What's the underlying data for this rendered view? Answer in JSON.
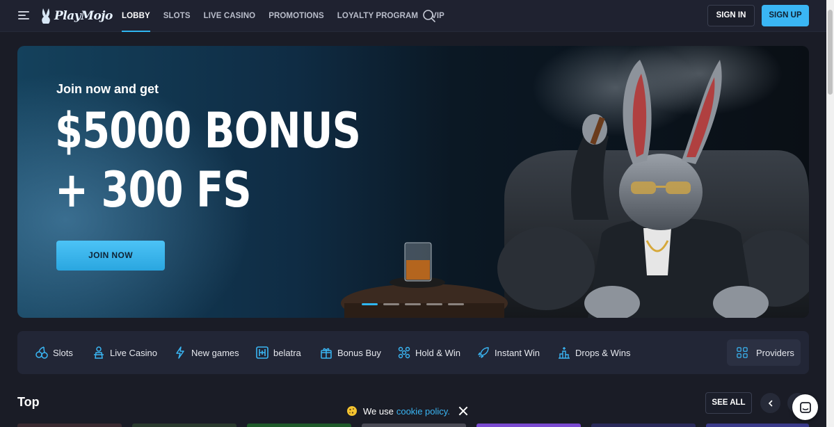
{
  "header": {
    "logo_text": "PlayMojo",
    "nav": [
      {
        "label": "LOBBY",
        "active": true
      },
      {
        "label": "SLOTS"
      },
      {
        "label": "LIVE CASINO"
      },
      {
        "label": "PROMOTIONS"
      },
      {
        "label": "LOYALTY PROGRAM"
      },
      {
        "label": "VIP"
      }
    ],
    "sign_in": "SIGN IN",
    "sign_up": "SIGN UP"
  },
  "hero": {
    "intro": "Join now and get",
    "headline_line1": "$5000 BONUS",
    "headline_line2": "+ 300 FS",
    "cta": "JOIN NOW",
    "slides": 5,
    "active_slide": 1
  },
  "categories": [
    {
      "label": "Slots",
      "icon": "cherries-icon"
    },
    {
      "label": "Live Casino",
      "icon": "dealer-icon"
    },
    {
      "label": "New games",
      "icon": "lightning-icon"
    },
    {
      "label": "belatra",
      "icon": "belatra-icon"
    },
    {
      "label": "Bonus Buy",
      "icon": "gift-icon"
    },
    {
      "label": "Hold & Win",
      "icon": "hold-win-icon"
    },
    {
      "label": "Instant Win",
      "icon": "rocket-icon"
    },
    {
      "label": "Drops & Wins",
      "icon": "drops-icon"
    }
  ],
  "providers_label": "Providers",
  "section": {
    "title": "Top",
    "see_all": "SEE ALL"
  },
  "cookie": {
    "text": "We use",
    "link": "cookie policy."
  },
  "colors": {
    "accent": "#3ab6f4",
    "background": "#1a1c26",
    "header": "#1f2230",
    "panel": "#222636"
  }
}
